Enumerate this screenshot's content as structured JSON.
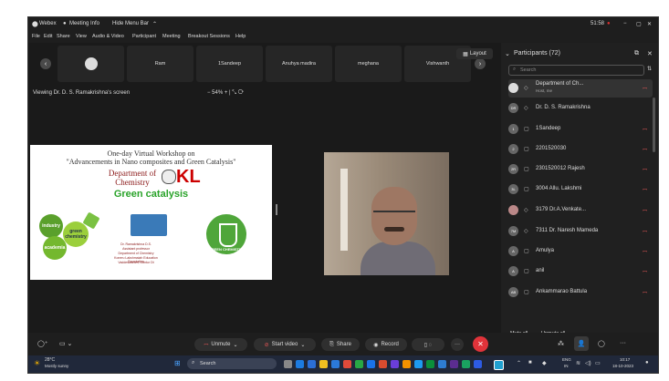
{
  "titlebar": {
    "app": "Webex",
    "meeting_info": "Meeting Info",
    "hide_menu": "Hide Menu Bar",
    "time": "51:58"
  },
  "menu": [
    "File",
    "Edit",
    "Share",
    "View",
    "Audio & Video",
    "Participant",
    "Meeting",
    "Breakout Sessions",
    "Help"
  ],
  "strip": {
    "names": [
      "Ram",
      "1Sandeep",
      "Anuhya madira",
      "meghana",
      "Vishwanth"
    ],
    "layout_label": "Layout"
  },
  "viewing": "Viewing Dr. D. S. Ramakrishna's screen",
  "zoom": "54%",
  "slide": {
    "title1": "One-day Virtual Workshop on",
    "title2": "\"Advancements in Nano composites and Green Catalysis\"",
    "dept": "Department of Chemistry",
    "kl": "KL",
    "green": "Green catalysis",
    "circles": [
      "industry",
      "green chemistry",
      "academia"
    ],
    "badge": "GREEN CHEMISTRY",
    "name": "Dr. Ramakrishna D.S.",
    "role": "Assistant professor",
    "dept_small": "Department of Chemistry",
    "univ": "Koneru Lakshmaiah Education Foundation",
    "place": "Vaddeswaram, Guntur Dt"
  },
  "participants": {
    "header": "Participants (72)",
    "search_placeholder": "Search",
    "list": [
      {
        "name": "Department of Ch...",
        "sub": "Host, me",
        "initials": "",
        "muted": true
      },
      {
        "name": "Dr. D. S. Ramakrishna",
        "sub": "",
        "initials": "DR",
        "muted": false
      },
      {
        "name": "1Sandeep",
        "sub": "",
        "initials": "1",
        "muted": true
      },
      {
        "name": "2201520030",
        "sub": "",
        "initials": "2",
        "muted": true
      },
      {
        "name": "2301520012 Rajesh",
        "sub": "",
        "initials": "2R",
        "muted": true
      },
      {
        "name": "3004 Allu. Lakshmi",
        "sub": "",
        "initials": "3L",
        "muted": true
      },
      {
        "name": "3179 Dr.A.Venkate...",
        "sub": "",
        "initials": "",
        "muted": true
      },
      {
        "name": "7311 Dr. Naresh Mameda",
        "sub": "",
        "initials": "7M",
        "muted": true
      },
      {
        "name": "Amulya",
        "sub": "",
        "initials": "A",
        "muted": true
      },
      {
        "name": "anil",
        "sub": "",
        "initials": "A",
        "muted": true
      },
      {
        "name": "Ankammarao Battula",
        "sub": "",
        "initials": "AB",
        "muted": true
      }
    ],
    "mute_all": "Mute all",
    "unmute_all": "Unmute all"
  },
  "controls": {
    "unmute": "Unmute",
    "start_video": "Start video",
    "share": "Share",
    "record": "Record"
  },
  "taskbar": {
    "temp": "28°C",
    "weather": "Mostly sunny",
    "search": "Search",
    "lang1": "ENG",
    "lang2": "IN",
    "time": "10:17",
    "date": "18-10-2023"
  },
  "colors": {
    "accent_red": "#e0333a",
    "mute_red": "#e05555",
    "panel_bg": "#202020"
  }
}
